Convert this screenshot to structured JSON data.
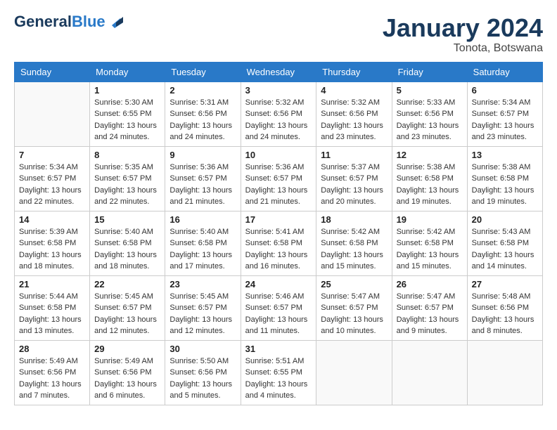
{
  "header": {
    "logo_general": "General",
    "logo_blue": "Blue",
    "month_year": "January 2024",
    "location": "Tonota, Botswana"
  },
  "days_of_week": [
    "Sunday",
    "Monday",
    "Tuesday",
    "Wednesday",
    "Thursday",
    "Friday",
    "Saturday"
  ],
  "weeks": [
    [
      {
        "day": "",
        "info": ""
      },
      {
        "day": "1",
        "info": "Sunrise: 5:30 AM\nSunset: 6:55 PM\nDaylight: 13 hours\nand 24 minutes."
      },
      {
        "day": "2",
        "info": "Sunrise: 5:31 AM\nSunset: 6:56 PM\nDaylight: 13 hours\nand 24 minutes."
      },
      {
        "day": "3",
        "info": "Sunrise: 5:32 AM\nSunset: 6:56 PM\nDaylight: 13 hours\nand 24 minutes."
      },
      {
        "day": "4",
        "info": "Sunrise: 5:32 AM\nSunset: 6:56 PM\nDaylight: 13 hours\nand 23 minutes."
      },
      {
        "day": "5",
        "info": "Sunrise: 5:33 AM\nSunset: 6:56 PM\nDaylight: 13 hours\nand 23 minutes."
      },
      {
        "day": "6",
        "info": "Sunrise: 5:34 AM\nSunset: 6:57 PM\nDaylight: 13 hours\nand 23 minutes."
      }
    ],
    [
      {
        "day": "7",
        "info": "Sunrise: 5:34 AM\nSunset: 6:57 PM\nDaylight: 13 hours\nand 22 minutes."
      },
      {
        "day": "8",
        "info": "Sunrise: 5:35 AM\nSunset: 6:57 PM\nDaylight: 13 hours\nand 22 minutes."
      },
      {
        "day": "9",
        "info": "Sunrise: 5:36 AM\nSunset: 6:57 PM\nDaylight: 13 hours\nand 21 minutes."
      },
      {
        "day": "10",
        "info": "Sunrise: 5:36 AM\nSunset: 6:57 PM\nDaylight: 13 hours\nand 21 minutes."
      },
      {
        "day": "11",
        "info": "Sunrise: 5:37 AM\nSunset: 6:57 PM\nDaylight: 13 hours\nand 20 minutes."
      },
      {
        "day": "12",
        "info": "Sunrise: 5:38 AM\nSunset: 6:58 PM\nDaylight: 13 hours\nand 19 minutes."
      },
      {
        "day": "13",
        "info": "Sunrise: 5:38 AM\nSunset: 6:58 PM\nDaylight: 13 hours\nand 19 minutes."
      }
    ],
    [
      {
        "day": "14",
        "info": "Sunrise: 5:39 AM\nSunset: 6:58 PM\nDaylight: 13 hours\nand 18 minutes."
      },
      {
        "day": "15",
        "info": "Sunrise: 5:40 AM\nSunset: 6:58 PM\nDaylight: 13 hours\nand 18 minutes."
      },
      {
        "day": "16",
        "info": "Sunrise: 5:40 AM\nSunset: 6:58 PM\nDaylight: 13 hours\nand 17 minutes."
      },
      {
        "day": "17",
        "info": "Sunrise: 5:41 AM\nSunset: 6:58 PM\nDaylight: 13 hours\nand 16 minutes."
      },
      {
        "day": "18",
        "info": "Sunrise: 5:42 AM\nSunset: 6:58 PM\nDaylight: 13 hours\nand 15 minutes."
      },
      {
        "day": "19",
        "info": "Sunrise: 5:42 AM\nSunset: 6:58 PM\nDaylight: 13 hours\nand 15 minutes."
      },
      {
        "day": "20",
        "info": "Sunrise: 5:43 AM\nSunset: 6:58 PM\nDaylight: 13 hours\nand 14 minutes."
      }
    ],
    [
      {
        "day": "21",
        "info": "Sunrise: 5:44 AM\nSunset: 6:58 PM\nDaylight: 13 hours\nand 13 minutes."
      },
      {
        "day": "22",
        "info": "Sunrise: 5:45 AM\nSunset: 6:57 PM\nDaylight: 13 hours\nand 12 minutes."
      },
      {
        "day": "23",
        "info": "Sunrise: 5:45 AM\nSunset: 6:57 PM\nDaylight: 13 hours\nand 12 minutes."
      },
      {
        "day": "24",
        "info": "Sunrise: 5:46 AM\nSunset: 6:57 PM\nDaylight: 13 hours\nand 11 minutes."
      },
      {
        "day": "25",
        "info": "Sunrise: 5:47 AM\nSunset: 6:57 PM\nDaylight: 13 hours\nand 10 minutes."
      },
      {
        "day": "26",
        "info": "Sunrise: 5:47 AM\nSunset: 6:57 PM\nDaylight: 13 hours\nand 9 minutes."
      },
      {
        "day": "27",
        "info": "Sunrise: 5:48 AM\nSunset: 6:56 PM\nDaylight: 13 hours\nand 8 minutes."
      }
    ],
    [
      {
        "day": "28",
        "info": "Sunrise: 5:49 AM\nSunset: 6:56 PM\nDaylight: 13 hours\nand 7 minutes."
      },
      {
        "day": "29",
        "info": "Sunrise: 5:49 AM\nSunset: 6:56 PM\nDaylight: 13 hours\nand 6 minutes."
      },
      {
        "day": "30",
        "info": "Sunrise: 5:50 AM\nSunset: 6:56 PM\nDaylight: 13 hours\nand 5 minutes."
      },
      {
        "day": "31",
        "info": "Sunrise: 5:51 AM\nSunset: 6:55 PM\nDaylight: 13 hours\nand 4 minutes."
      },
      {
        "day": "",
        "info": ""
      },
      {
        "day": "",
        "info": ""
      },
      {
        "day": "",
        "info": ""
      }
    ]
  ]
}
